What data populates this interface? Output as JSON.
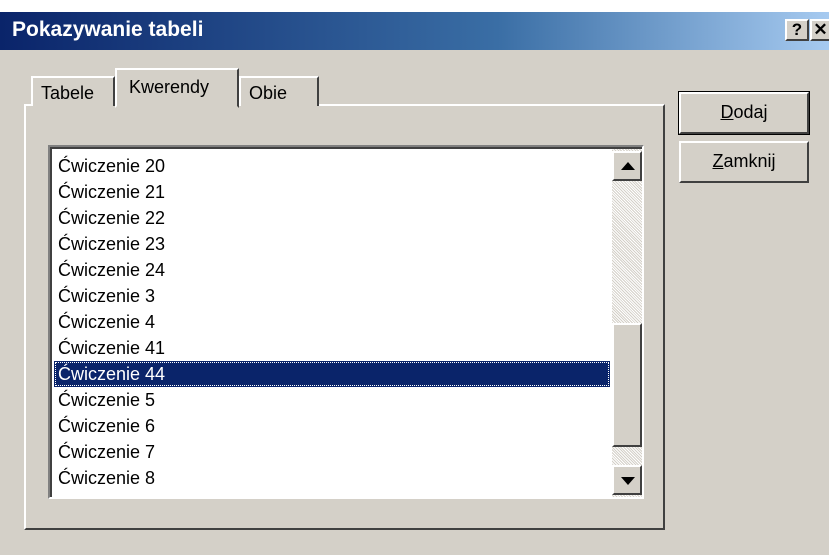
{
  "window": {
    "title": "Pokazywanie tabeli",
    "help_label": "?",
    "close_label": "✕"
  },
  "tabs": [
    {
      "label": "Tabele",
      "active": false
    },
    {
      "label": "Kwerendy",
      "active": true
    },
    {
      "label": "Obie",
      "active": false
    }
  ],
  "list": {
    "items": [
      "Ćwiczenie 20",
      "Ćwiczenie 21",
      "Ćwiczenie 22",
      "Ćwiczenie 23",
      "Ćwiczenie 24",
      "Ćwiczenie 3",
      "Ćwiczenie 4",
      "Ćwiczenie 41",
      "Ćwiczenie 44",
      "Ćwiczenie 5",
      "Ćwiczenie 6",
      "Ćwiczenie 7",
      "Ćwiczenie 8"
    ],
    "selected": "Ćwiczenie 44"
  },
  "buttons": {
    "add": {
      "accel": "D",
      "rest": "odaj"
    },
    "close": {
      "accel": "Z",
      "rest": "amknij"
    }
  },
  "colors": {
    "title_bar": "#0a246a",
    "selection": "#0a246a",
    "face": "#d4d0c8"
  }
}
